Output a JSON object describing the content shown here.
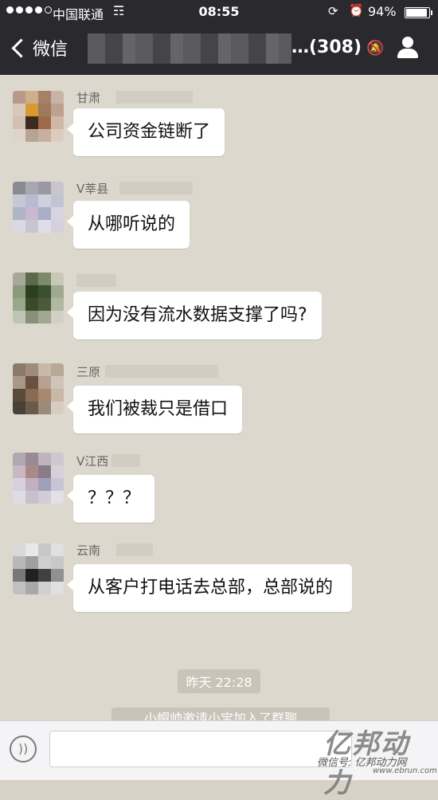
{
  "status_bar": {
    "carrier": "中国联通",
    "time": "08:55",
    "battery": "94%"
  },
  "nav": {
    "back_label": "微信",
    "title": "…(308)"
  },
  "messages": [
    {
      "sender": "甘肃",
      "text": "公司资金链断了"
    },
    {
      "sender": "V莘县",
      "text": "从哪听说的"
    },
    {
      "sender": "",
      "text": "因为没有流水数据支撑了吗?"
    },
    {
      "sender": "三原",
      "text": "我们被裁只是借口"
    },
    {
      "sender": "V江西",
      "text": "？？？"
    },
    {
      "sender": "云南",
      "text": "从客户打电话去总部，总部说的"
    }
  ],
  "timestamp": "昨天 22:28",
  "system_note": "小帽帅邀请小宝加入了群聊",
  "watermark": {
    "main": "亿邦动力",
    "sub": "微信号: 亿邦动力网",
    "url": "www.ebrun.com"
  },
  "icons": {
    "signal": "signal-dots-icon",
    "wifi": "wifi-icon",
    "lock": "rotation-lock-icon",
    "alarm": "alarm-icon",
    "battery": "battery-icon",
    "back": "chevron-left-icon",
    "mute": "mute-bell-icon",
    "contacts": "group-member-icon",
    "voice": "voice-input-icon"
  },
  "colors": {
    "bar": "#2a2a2e",
    "chat_bg": "#ddd8cd",
    "bubble": "#ffffff"
  }
}
